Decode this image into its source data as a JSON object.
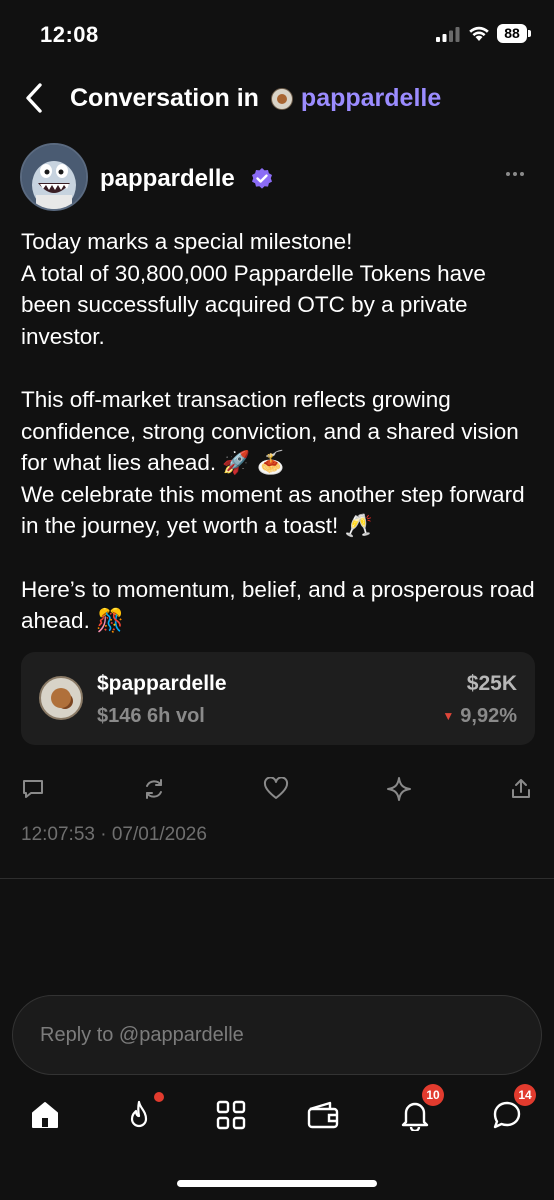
{
  "status_bar": {
    "time": "12:08",
    "battery": "88"
  },
  "header": {
    "back_icon": "chevron-left-icon",
    "title_prefix": "Conversation in",
    "community_name": "pappardelle"
  },
  "post": {
    "author": "pappardelle",
    "verified": true,
    "more_icon": "ellipsis-icon",
    "paragraph_1": "Today marks a special milestone!\nA total of 30,800,000 Pappardelle Tokens have been successfully acquired OTC by a private investor.",
    "paragraph_2": "This off-market transaction reflects growing confidence, strong conviction, and a shared vision for what lies ahead. 🚀 🍝\nWe celebrate this moment as another step forward in the journey, yet worth a toast! 🥂",
    "paragraph_3": "Here’s to momentum, belief, and a prosperous road ahead. 🎊",
    "timestamp": "12:07:53 · 07/01/2026"
  },
  "token_card": {
    "symbol": "$pappardelle",
    "volume": "$146 6h vol",
    "market_cap": "$25K",
    "change": "9,92%",
    "change_direction": "down",
    "down_color": "#e0463a"
  },
  "actions": {
    "reply_icon": "comment-icon",
    "repost_icon": "repost-icon",
    "like_icon": "heart-icon",
    "boost_icon": "sparkle-icon",
    "share_icon": "share-icon"
  },
  "reply": {
    "placeholder": "Reply to @pappardelle"
  },
  "bottom_nav": {
    "items": [
      {
        "icon": "home-icon"
      },
      {
        "icon": "flame-icon",
        "dot": true
      },
      {
        "icon": "grid-icon"
      },
      {
        "icon": "wallet-icon"
      },
      {
        "icon": "bell-icon",
        "badge": "10"
      },
      {
        "icon": "chat-icon",
        "badge": "14"
      }
    ]
  },
  "colors": {
    "background": "#111111",
    "accent": "#9b8cff",
    "badge": "#e23b2e"
  }
}
